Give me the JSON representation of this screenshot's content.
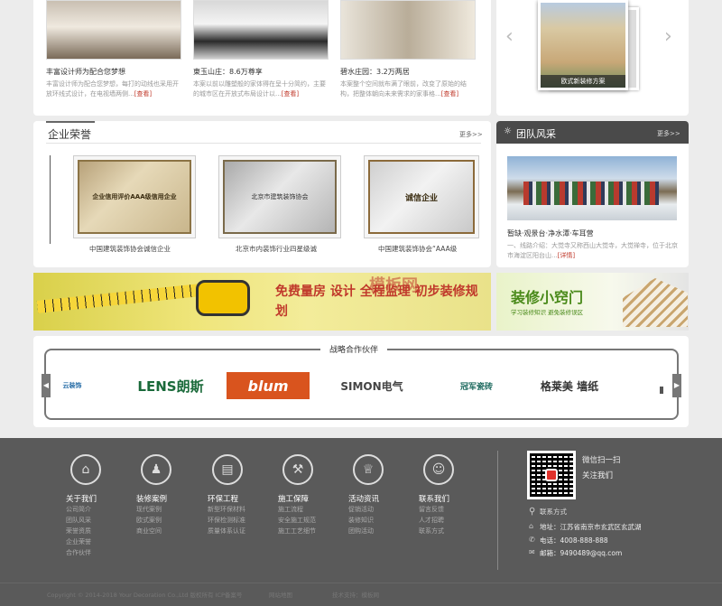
{
  "cases": [
    {
      "title": "丰富设计师为配合您梦想",
      "desc": "丰富设计师为配合您梦想，每打的动线也采用开放环线式设计，在电视墙两侧...",
      "more": "[查看]"
    },
    {
      "title": "東玉山庄：8.6万尊享",
      "desc": "本案以前以雕塑般的家体得在呈十分简约，主要的城市区在开放式布局设计以...",
      "more": "[查看]"
    },
    {
      "title": "碧水庄园：3.2万两居",
      "desc": "本案整个空间就布满了眼前，改变了原始的结构，把整体朝向未来需求的家事格...",
      "more": "[查看]"
    }
  ],
  "slider": {
    "caption": "欧式新装修方案",
    "prev": "‹",
    "next": "›"
  },
  "honors": {
    "title": "企业荣誉",
    "more": "更多>>",
    "certs": [
      {
        "caption": "中国建筑装饰协会诚信企业",
        "text": "企业信用评价AAA级信用企业"
      },
      {
        "caption": "北京市内装饰行业四星级诚",
        "text": "北京市建筑装饰协会"
      },
      {
        "caption": "中国建筑装饰协会“AAA级",
        "text": "诚信企业"
      }
    ]
  },
  "team": {
    "title": "团队风采",
    "more": "更多>>",
    "news_title": "暂缺·观景台·净水潭·车耳营",
    "news_desc": "一、线路介绍：大觉寺又称西山大觉寺，大觉禅寺，位于北京市海淀区阳台山...",
    "news_more": "[详情]"
  },
  "banners": {
    "left": {
      "main": "免费量房 设计 全程监理 初步装修规划",
      "watermark": "模板网"
    },
    "right": {
      "title": "装修小窍门",
      "sub": "学习装修知识 避免装修误区"
    }
  },
  "partners": {
    "title": "战略合作伙伴",
    "logos": [
      "云装饰",
      "LENS朗斯",
      "blum",
      "SIMON电气",
      "冠军瓷砖",
      "格莱美 墙纸"
    ]
  },
  "footer": {
    "columns": [
      {
        "icon": "⌂",
        "head": "关于我们",
        "links": [
          "公司简介",
          "团队风采",
          "荣誉资质",
          "企业荣誉",
          "合作伙伴"
        ]
      },
      {
        "icon": "♟",
        "head": "装修案例",
        "links": [
          "现代案例",
          "欧式案例",
          "商业空间"
        ]
      },
      {
        "icon": "▤",
        "head": "环保工程",
        "links": [
          "新型环保材料",
          "环保检测标准",
          "质量体系认证"
        ]
      },
      {
        "icon": "⚒",
        "head": "施工保障",
        "links": [
          "施工流程",
          "安全施工规范",
          "施工工艺细节"
        ]
      },
      {
        "icon": "♕",
        "head": "活动资讯",
        "links": [
          "促销活动",
          "装修知识",
          "团购活动"
        ]
      },
      {
        "icon": "☺",
        "head": "联系我们",
        "links": [
          "留言反馈",
          "人才招聘",
          "联系方式"
        ]
      }
    ],
    "qr_text1": "微信扫一扫",
    "qr_text2": "关注我们",
    "contact_title": "联系方式",
    "address": "地址：江苏省南京市玄武区玄武湖",
    "phone": "电话：4008-888-888",
    "email": "邮箱：9490489@qq.com",
    "copyright": "Copyright © 2014-2018 Your Decoration Co.,Ltd 版权所有 ICP备案号",
    "bottom2": "网站地图",
    "bottom3": "技术支持：模板网"
  },
  "colors": {
    "accent": "#c0392b",
    "footer_bg": "#5a5a5a",
    "dark_header": "#4a4a4a"
  }
}
